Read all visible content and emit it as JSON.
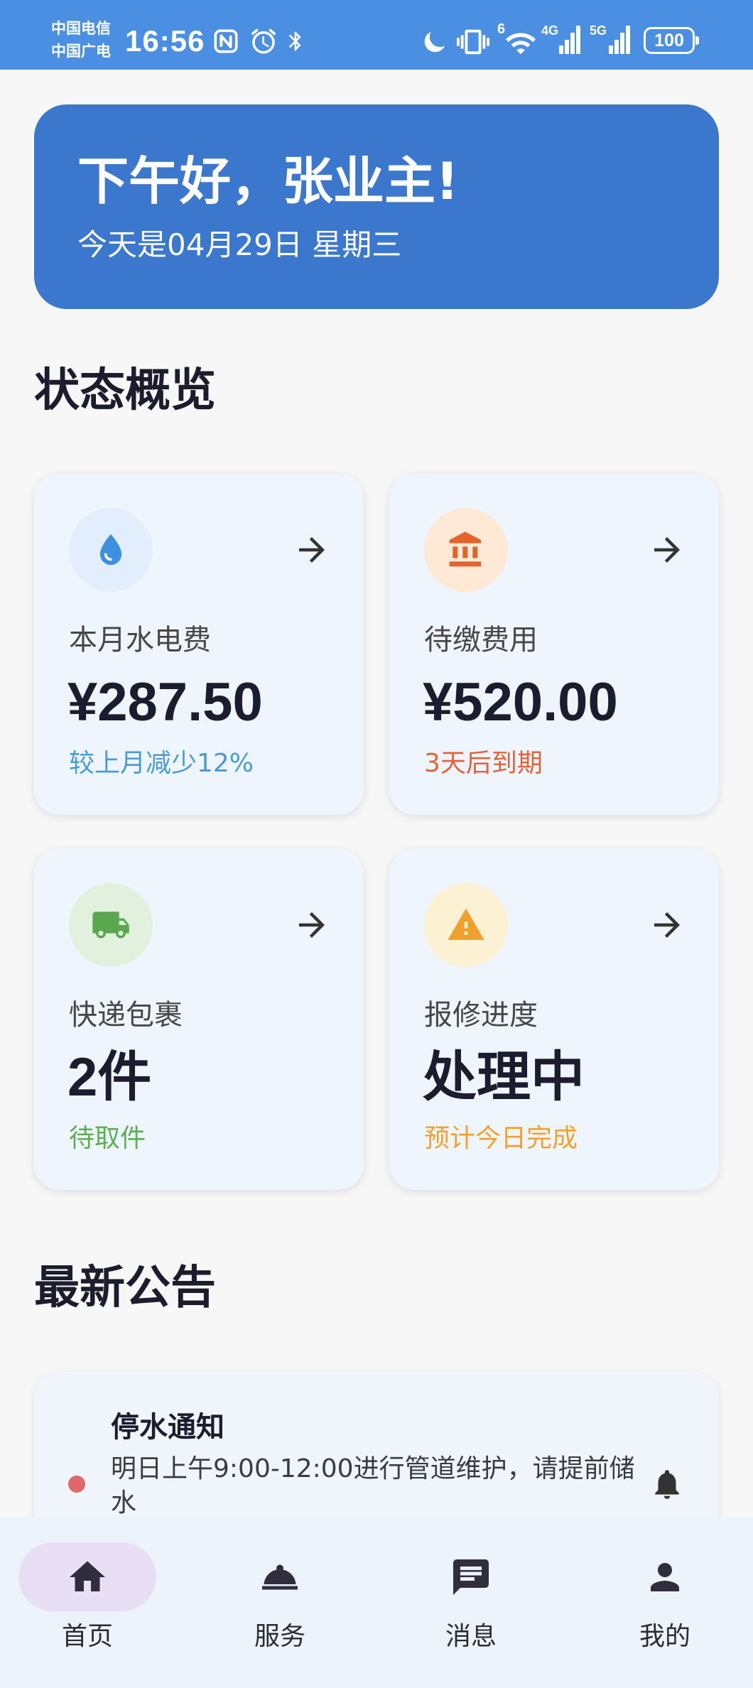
{
  "status_bar": {
    "carrier_primary": "中国电信",
    "carrier_secondary": "中国广电",
    "time": "16:56",
    "wifi_generation": "6",
    "sim1_network": "4G",
    "sim2_network": "5G",
    "battery_level": "100",
    "icons": [
      "nfc-icon",
      "alarm-icon",
      "bluetooth-icon",
      "moon-icon",
      "vibrate-icon",
      "wifi-icon",
      "signal-icon",
      "battery-icon"
    ]
  },
  "greeting": {
    "title": "下午好，张业主!",
    "date_line": "今天是04月29日 星期三"
  },
  "overview": {
    "title": "状态概览",
    "cards": [
      {
        "icon": "water-drop-icon",
        "label": "本月水电费",
        "value": "¥287.50",
        "note": "较上月减少12%",
        "icon_color": "#3d8fe0",
        "icon_bg": "#e2eefb",
        "note_color": "#4a9cd6"
      },
      {
        "icon": "bank-icon",
        "label": "待缴费用",
        "value": "¥520.00",
        "note": "3天后到期",
        "icon_color": "#e0642c",
        "icon_bg": "#fde9d6",
        "note_color": "#e2643a"
      },
      {
        "icon": "truck-icon",
        "label": "快递包裹",
        "value": "2件",
        "note": "待取件",
        "icon_color": "#5aa84e",
        "icon_bg": "#e2f0de",
        "note_color": "#5daf54"
      },
      {
        "icon": "warning-icon",
        "label": "报修进度",
        "value": "处理中",
        "note": "预计今日完成",
        "icon_color": "#f0a02c",
        "icon_bg": "#fcf1d3",
        "note_color": "#f0a12e"
      }
    ]
  },
  "announcements": {
    "title": "最新公告",
    "items": [
      {
        "title": "停水通知",
        "body": "明日上午9:00-12:00进行管道维护，请提前储水",
        "icon": "bell-icon",
        "dot_color": "#e06868"
      }
    ]
  },
  "nav": {
    "active_index": 0,
    "items": [
      {
        "label": "首页",
        "icon": "home-icon"
      },
      {
        "label": "服务",
        "icon": "room-service-icon"
      },
      {
        "label": "消息",
        "icon": "message-icon"
      },
      {
        "label": "我的",
        "icon": "person-icon"
      }
    ]
  },
  "colors": {
    "page_bg": "#f7f7f7",
    "status_bar_bg": "#4a8fe1",
    "greeting_bg": "#3b78cd",
    "card_bg": "#eff5fc",
    "nav_bg": "#edf3fb",
    "nav_active_pill": "#e8dff5",
    "title_text": "#1c1d2c"
  }
}
